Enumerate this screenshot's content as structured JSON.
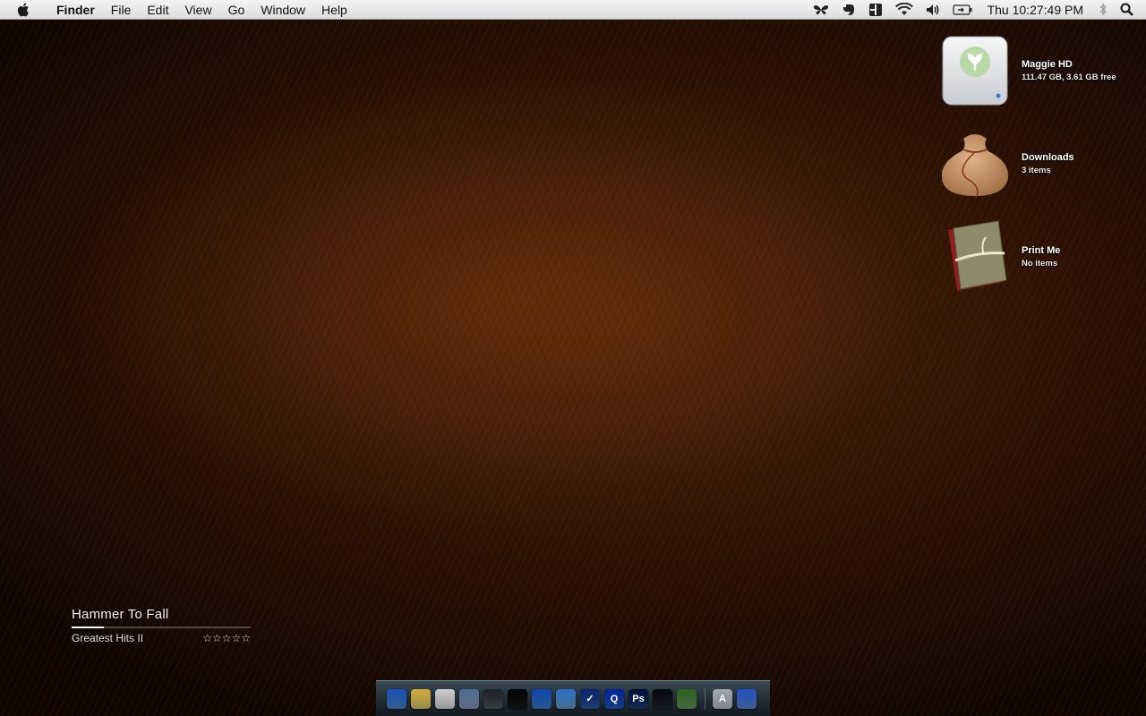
{
  "menubar": {
    "app_name": "Finder",
    "menus": [
      "File",
      "Edit",
      "View",
      "Go",
      "Window",
      "Help"
    ],
    "status_icons": [
      "butterfly-icon",
      "evernote-icon",
      "split-icon",
      "wifi-icon",
      "volume-icon",
      "battery-icon"
    ],
    "clock": "Thu 10:27:49 PM"
  },
  "desktop": {
    "items": [
      {
        "name": "Maggie HD",
        "detail": "111.47 GB, 3.61 GB free",
        "icon": "hard-drive-icon"
      },
      {
        "name": "Downloads",
        "detail": "3 items",
        "icon": "sack-icon"
      },
      {
        "name": "Print Me",
        "detail": "No items",
        "icon": "book-icon"
      }
    ]
  },
  "now_playing": {
    "title": "Hammer To Fall",
    "album": "Greatest Hits II",
    "progress": 0.18,
    "rating_max": 5,
    "rating_stars": "☆☆☆☆☆"
  },
  "dock": {
    "apps": [
      {
        "name": "finder-icon",
        "color": "#4f8fd8",
        "glyph": ""
      },
      {
        "name": "notes-icon",
        "color": "#e8d27a",
        "glyph": ""
      },
      {
        "name": "textedit-icon",
        "color": "#e6e6e6",
        "glyph": ""
      },
      {
        "name": "preview-icon",
        "color": "#8fa6c6",
        "glyph": ""
      },
      {
        "name": "cassette-icon",
        "color": "#555a60",
        "glyph": ""
      },
      {
        "name": "binoculars-icon",
        "color": "#1b1b1b",
        "glyph": ""
      },
      {
        "name": "globe-icon",
        "color": "#3a86d4",
        "glyph": ""
      },
      {
        "name": "alarm-clock-icon",
        "color": "#6aa9de",
        "glyph": ""
      },
      {
        "name": "checklist-icon",
        "color": "#2f5fa8",
        "glyph": "✓"
      },
      {
        "name": "quicktime-icon",
        "color": "#1c5fc6",
        "glyph": "Q"
      },
      {
        "name": "photoshop-icon",
        "color": "#1a3f7a",
        "glyph": "Ps"
      },
      {
        "name": "terminal-icon",
        "color": "#222831",
        "glyph": ""
      },
      {
        "name": "tool-icon",
        "color": "#6aa05a",
        "glyph": ""
      }
    ],
    "stack_icons": [
      {
        "name": "applications-folder-icon",
        "color": "#c9ced6",
        "glyph": "A"
      },
      {
        "name": "trash-icon",
        "color": "#5f8ee0",
        "glyph": ""
      }
    ]
  }
}
